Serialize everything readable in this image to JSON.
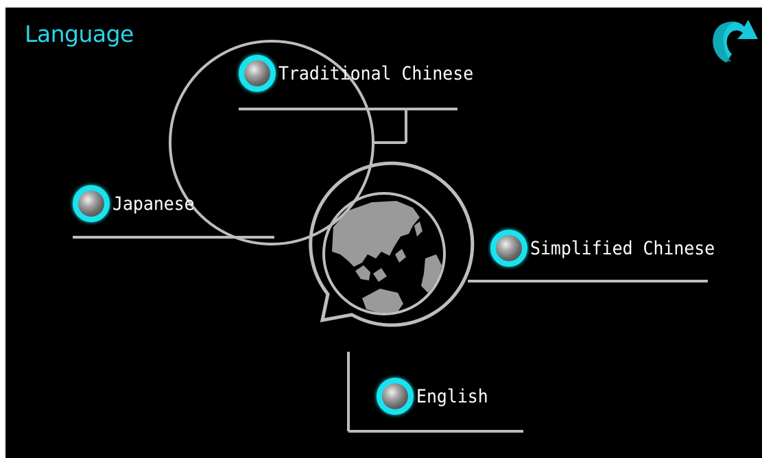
{
  "header": {
    "title": "Language",
    "back_icon": "back-arrow-icon"
  },
  "languages": [
    {
      "label": "Traditional Chinese",
      "selected": false
    },
    {
      "label": "Japanese",
      "selected": false
    },
    {
      "label": "Simplified Chinese",
      "selected": false
    },
    {
      "label": "English",
      "selected": false
    }
  ],
  "colors": {
    "accent": "#18e4f0",
    "title": "#2ad6e6",
    "line": "#bdbdbd",
    "background": "#000000"
  },
  "center_icon": "globe-icon"
}
